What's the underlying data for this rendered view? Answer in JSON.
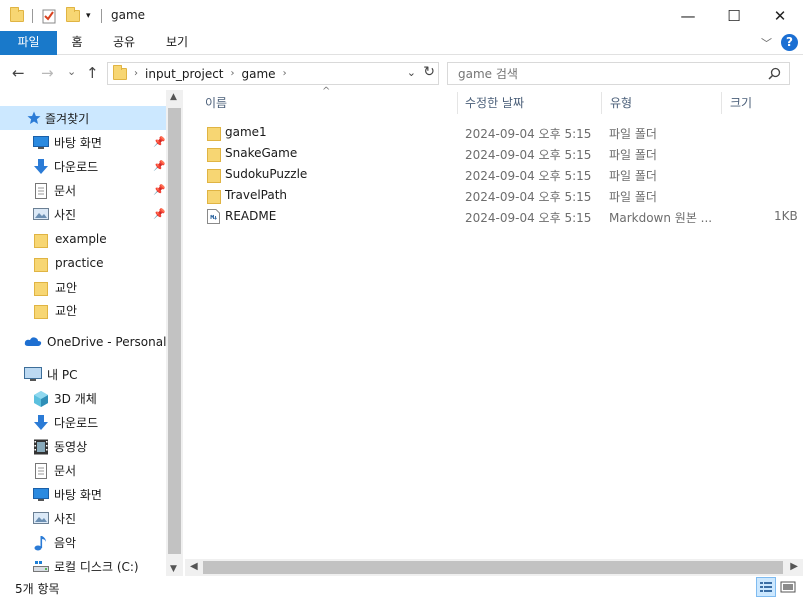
{
  "window": {
    "title": "game",
    "minimize_glyph": "—",
    "maximize_glyph": "☐",
    "close_glyph": "✕"
  },
  "ribbon": {
    "tabs": [
      "파일",
      "홈",
      "공유",
      "보기"
    ],
    "expand_glyph": "﹀",
    "help_glyph": "?"
  },
  "nav": {
    "back": "←",
    "forward": "→",
    "recent": "⌄",
    "up": "↑",
    "breadcrumb": [
      "input_project",
      "game"
    ],
    "dropdown_glyph": "⌄",
    "refresh_glyph": "↻"
  },
  "search": {
    "placeholder": "game 검색"
  },
  "sidebar": {
    "quick_access": "즐겨찾기",
    "pinned": [
      {
        "label": "바탕 화면",
        "icon": "desktop-icon"
      },
      {
        "label": "다운로드",
        "icon": "download-icon"
      },
      {
        "label": "문서",
        "icon": "document-icon"
      },
      {
        "label": "사진",
        "icon": "picture-icon"
      }
    ],
    "folders": [
      "example",
      "practice",
      "교안",
      "교안"
    ],
    "onedrive": "OneDrive - Personal",
    "this_pc": "내 PC",
    "pc_items": [
      {
        "label": "3D 개체",
        "icon": "3d-objects-icon"
      },
      {
        "label": "다운로드",
        "icon": "download-icon"
      },
      {
        "label": "동영상",
        "icon": "video-icon"
      },
      {
        "label": "문서",
        "icon": "document-icon"
      },
      {
        "label": "바탕 화면",
        "icon": "desktop-icon"
      },
      {
        "label": "사진",
        "icon": "picture-icon"
      },
      {
        "label": "음악",
        "icon": "music-icon"
      },
      {
        "label": "로컬 디스크 (C:)",
        "icon": "drive-icon"
      }
    ]
  },
  "columns": [
    "이름",
    "수정한 날짜",
    "유형",
    "크기"
  ],
  "files": [
    {
      "name": "game1",
      "date": "2024-09-04 오후 5:15",
      "type": "파일 폴더",
      "size": "",
      "kind": "folder"
    },
    {
      "name": "SnakeGame",
      "date": "2024-09-04 오후 5:15",
      "type": "파일 폴더",
      "size": "",
      "kind": "folder"
    },
    {
      "name": "SudokuPuzzle",
      "date": "2024-09-04 오후 5:15",
      "type": "파일 폴더",
      "size": "",
      "kind": "folder"
    },
    {
      "name": "TravelPath",
      "date": "2024-09-04 오후 5:15",
      "type": "파일 폴더",
      "size": "",
      "kind": "folder"
    },
    {
      "name": "README",
      "date": "2024-09-04 오후 5:15",
      "type": "Markdown 원본 ...",
      "size": "1KB",
      "kind": "file"
    }
  ],
  "status": {
    "count": "5개 항목"
  },
  "colors": {
    "accent": "#1979ca",
    "selected": "#cce8ff",
    "folder": "#f7d673"
  }
}
